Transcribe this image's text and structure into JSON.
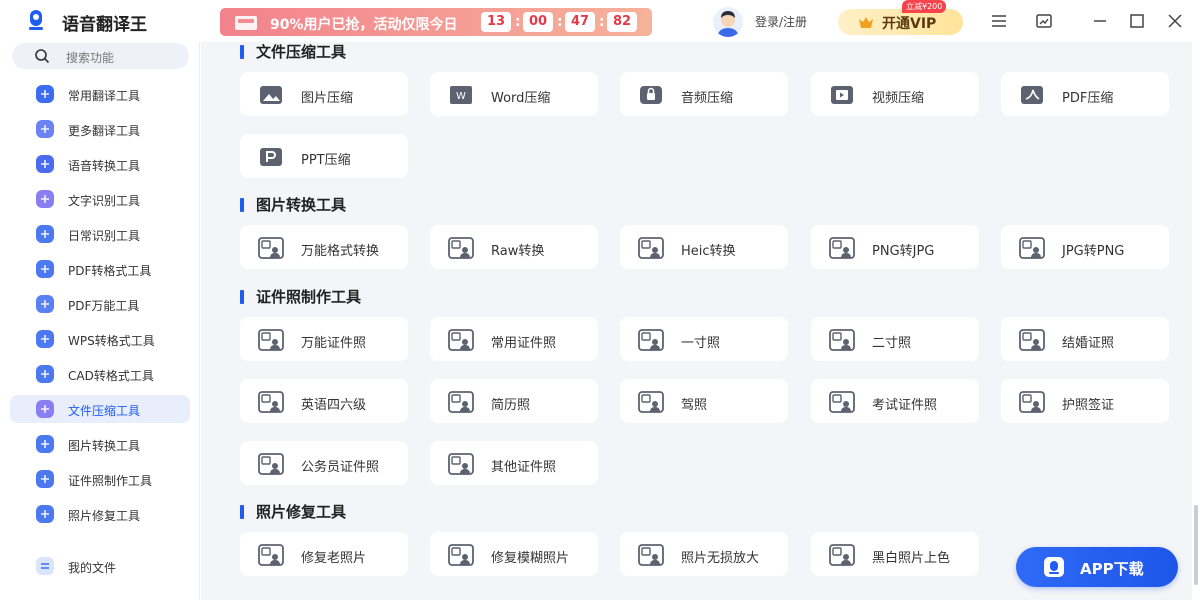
{
  "app": {
    "title": "语音翻译王",
    "promo_text": "90%用户已抢，活动仅限今日",
    "countdown": [
      "13",
      "00",
      "47",
      "82"
    ],
    "login": "登录/注册",
    "vip_label": "开通VIP",
    "vip_badge": "立减¥200"
  },
  "colors": {
    "accent": "#1f5cf0",
    "promo": "#f3828c",
    "vip": "#ffe39a",
    "page_bg": "#f4f5f8"
  },
  "sidebar": {
    "search_placeholder": "搜索功能",
    "items": [
      {
        "label": "常用翻译工具",
        "icon": "translate-icon",
        "color": "#3b6cf2"
      },
      {
        "label": "更多翻译工具",
        "icon": "more-translate-icon",
        "color": "#6b83f5"
      },
      {
        "label": "语音转换工具",
        "icon": "music-note-icon",
        "color": "#4c6cf0"
      },
      {
        "label": "文字识别工具",
        "icon": "text-recognition-icon",
        "color": "#8a7ff2"
      },
      {
        "label": "日常识别工具",
        "icon": "daily-recognition-icon",
        "color": "#4c78f0"
      },
      {
        "label": "PDF转格式工具",
        "icon": "pdf-convert-icon",
        "color": "#4c78f0"
      },
      {
        "label": "PDF万能工具",
        "icon": "pdf-tools-icon",
        "color": "#5b80f2"
      },
      {
        "label": "WPS转格式工具",
        "icon": "wps-convert-icon",
        "color": "#4c78f0"
      },
      {
        "label": "CAD转格式工具",
        "icon": "cad-convert-icon",
        "color": "#4c78f0"
      },
      {
        "label": "文件压缩工具",
        "icon": "file-compress-icon",
        "color": "#8a7ff2",
        "active": true
      },
      {
        "label": "图片转换工具",
        "icon": "image-convert-icon",
        "color": "#4c78f0"
      },
      {
        "label": "证件照制作工具",
        "icon": "id-photo-icon",
        "color": "#4c78f0"
      },
      {
        "label": "照片修复工具",
        "icon": "photo-repair-icon",
        "color": "#4c78f0"
      }
    ],
    "my_files": "我的文件"
  },
  "sections": [
    {
      "title": "文件压缩工具",
      "rows": [
        [
          {
            "label": "图片压缩",
            "icon": "image-icon"
          },
          {
            "label": "Word压缩",
            "icon": "word-icon"
          },
          {
            "label": "音频压缩",
            "icon": "audio-lock-icon"
          },
          {
            "label": "视频压缩",
            "icon": "video-icon"
          },
          {
            "label": "PDF压缩",
            "icon": "pdf-icon"
          }
        ],
        [
          {
            "label": "PPT压缩",
            "icon": "ppt-icon"
          }
        ]
      ]
    },
    {
      "title": "图片转换工具",
      "rows": [
        [
          {
            "label": "万能格式转换",
            "icon": "universal-convert-icon"
          },
          {
            "label": "Raw转换",
            "icon": "raw-icon"
          },
          {
            "label": "Heic转换",
            "icon": "heic-icon"
          },
          {
            "label": "PNG转JPG",
            "icon": "png-jpg-icon"
          },
          {
            "label": "JPG转PNG",
            "icon": "jpg-png-icon"
          }
        ]
      ]
    },
    {
      "title": "证件照制作工具",
      "rows": [
        [
          {
            "label": "万能证件照",
            "icon": "universal-id-icon"
          },
          {
            "label": "常用证件照",
            "icon": "common-id-icon"
          },
          {
            "label": "一寸照",
            "icon": "one-inch-icon"
          },
          {
            "label": "二寸照",
            "icon": "two-inch-icon"
          },
          {
            "label": "结婚证照",
            "icon": "marriage-photo-icon"
          }
        ],
        [
          {
            "label": "英语四六级",
            "icon": "english-exam-icon"
          },
          {
            "label": "简历照",
            "icon": "resume-photo-icon"
          },
          {
            "label": "驾照",
            "icon": "driver-license-icon"
          },
          {
            "label": "考试证件照",
            "icon": "exam-photo-icon"
          },
          {
            "label": "护照签证",
            "icon": "passport-icon"
          }
        ],
        [
          {
            "label": "公务员证件照",
            "icon": "civil-servant-icon"
          },
          {
            "label": "其他证件照",
            "icon": "other-id-icon"
          }
        ]
      ]
    },
    {
      "title": "照片修复工具",
      "rows": [
        [
          {
            "label": "修复老照片",
            "icon": "old-photo-icon"
          },
          {
            "label": "修复模糊照片",
            "icon": "blur-photo-icon"
          },
          {
            "label": "照片无损放大",
            "icon": "upscale-icon"
          },
          {
            "label": "黑白照片上色",
            "icon": "colorize-icon"
          }
        ]
      ]
    }
  ],
  "app_download": "APP下载"
}
